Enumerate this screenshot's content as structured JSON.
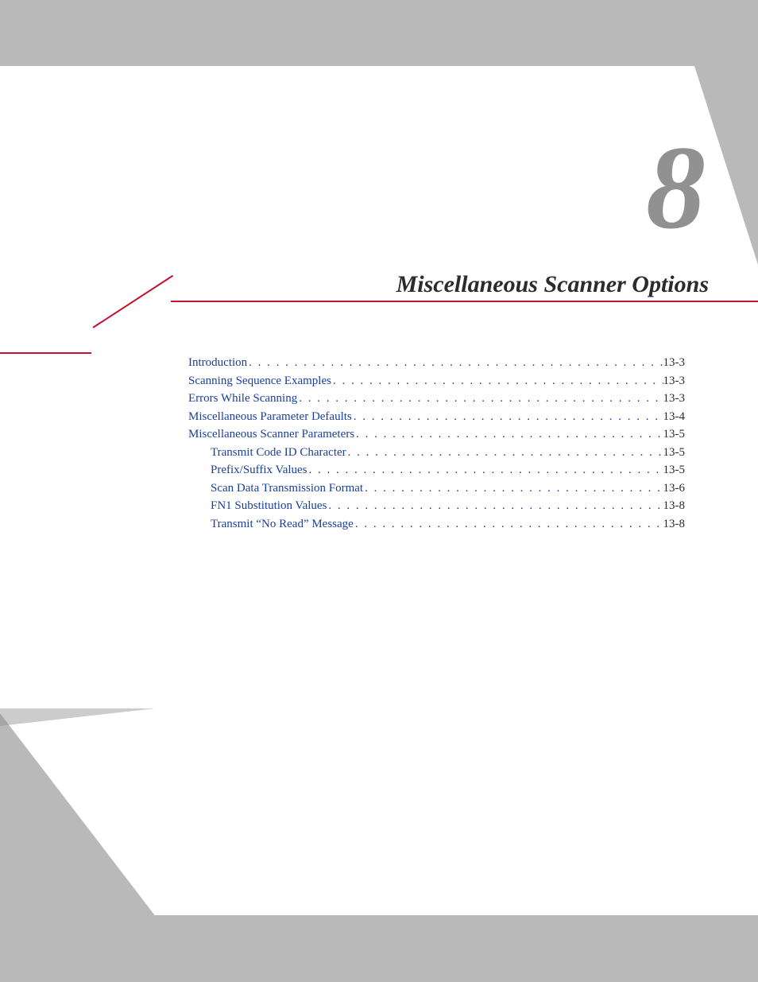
{
  "chapter": {
    "number": "8",
    "title": "Miscellaneous Scanner Options"
  },
  "toc": [
    {
      "label": "Introduction",
      "page": "13-3",
      "indent": false
    },
    {
      "label": "Scanning Sequence Examples",
      "page": "13-3",
      "indent": false
    },
    {
      "label": "Errors While Scanning",
      "page": "13-3",
      "indent": false
    },
    {
      "label": "Miscellaneous Parameter Defaults",
      "page": "13-4",
      "indent": false
    },
    {
      "label": "Miscellaneous Scanner Parameters",
      "page": "13-5",
      "indent": false
    },
    {
      "label": "Transmit Code ID Character",
      "page": "13-5",
      "indent": true
    },
    {
      "label": "Prefix/Suffix Values",
      "page": "13-5",
      "indent": true
    },
    {
      "label": "Scan Data Transmission Format",
      "page": "13-6",
      "indent": true
    },
    {
      "label": "FN1 Substitution Values",
      "page": "13-8",
      "indent": true
    },
    {
      "label": "Transmit “No Read” Message",
      "page": "13-8",
      "indent": true
    }
  ]
}
